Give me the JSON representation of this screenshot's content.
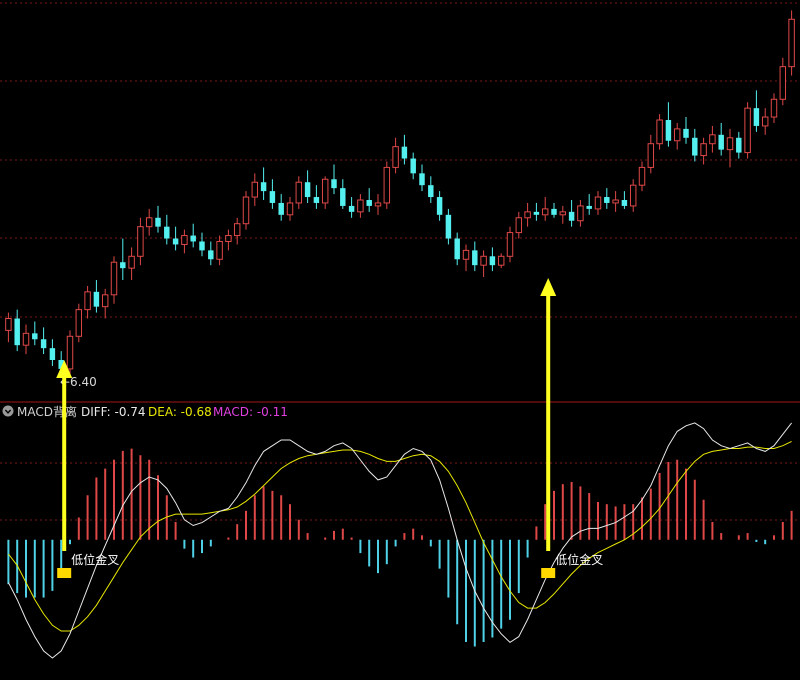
{
  "colors": {
    "background": "#000000",
    "up_candle": "#e04848",
    "down_candle": "#54f0f0",
    "grid": "#7a1a1a",
    "divider": "#a01818",
    "diff_line": "#e8e8e8",
    "dea_line": "#e8e800",
    "macd_pos": "#e04848",
    "macd_neg": "#4fd2e8",
    "arrow": "#ffff20",
    "signal_marker": "#ffd800",
    "legend_label": "#cfcfcf",
    "dea_label": "#e8e800",
    "macd_label": "#e040e0",
    "low_marker": "#d8d8d8"
  },
  "icons": {
    "panel_toggle": "chevron-down-circle-icon"
  },
  "price_panel": {
    "low_marker_label": "←6.40"
  },
  "macd_panel": {
    "indicator_name": "MACD背离",
    "diff_label": "DIFF: -0.74",
    "dea_label": "DEA: -0.68",
    "macd_label": "MACD: -0.11"
  },
  "chart_data": [
    {
      "type": "candlestick",
      "title": "",
      "xlabel": "",
      "ylabel": "",
      "grid": true,
      "ylim": [
        6.25,
        8.95
      ],
      "candles": [
        [
          6.72,
          6.84,
          6.64,
          6.8
        ],
        [
          6.8,
          6.86,
          6.58,
          6.62
        ],
        [
          6.62,
          6.76,
          6.56,
          6.7
        ],
        [
          6.7,
          6.78,
          6.62,
          6.66
        ],
        [
          6.66,
          6.74,
          6.56,
          6.6
        ],
        [
          6.6,
          6.66,
          6.48,
          6.52
        ],
        [
          6.52,
          6.58,
          6.42,
          6.46
        ],
        [
          6.46,
          6.72,
          6.4,
          6.68
        ],
        [
          6.68,
          6.9,
          6.64,
          6.86
        ],
        [
          6.86,
          7.02,
          6.8,
          6.98
        ],
        [
          6.98,
          7.06,
          6.84,
          6.88
        ],
        [
          6.88,
          7.0,
          6.8,
          6.96
        ],
        [
          6.96,
          7.22,
          6.9,
          7.18
        ],
        [
          7.18,
          7.34,
          7.06,
          7.14
        ],
        [
          7.14,
          7.28,
          7.06,
          7.22
        ],
        [
          7.22,
          7.48,
          7.16,
          7.42
        ],
        [
          7.42,
          7.54,
          7.36,
          7.48
        ],
        [
          7.48,
          7.56,
          7.38,
          7.42
        ],
        [
          7.42,
          7.5,
          7.3,
          7.34
        ],
        [
          7.34,
          7.42,
          7.26,
          7.3
        ],
        [
          7.3,
          7.4,
          7.24,
          7.36
        ],
        [
          7.36,
          7.44,
          7.28,
          7.32
        ],
        [
          7.32,
          7.38,
          7.22,
          7.26
        ],
        [
          7.26,
          7.32,
          7.16,
          7.2
        ],
        [
          7.2,
          7.36,
          7.16,
          7.32
        ],
        [
          7.32,
          7.4,
          7.26,
          7.36
        ],
        [
          7.36,
          7.48,
          7.3,
          7.44
        ],
        [
          7.44,
          7.66,
          7.4,
          7.62
        ],
        [
          7.62,
          7.78,
          7.56,
          7.72
        ],
        [
          7.72,
          7.82,
          7.6,
          7.66
        ],
        [
          7.66,
          7.74,
          7.54,
          7.58
        ],
        [
          7.58,
          7.64,
          7.46,
          7.5
        ],
        [
          7.5,
          7.62,
          7.46,
          7.58
        ],
        [
          7.58,
          7.76,
          7.54,
          7.72
        ],
        [
          7.72,
          7.8,
          7.58,
          7.62
        ],
        [
          7.62,
          7.7,
          7.54,
          7.58
        ],
        [
          7.58,
          7.76,
          7.54,
          7.74
        ],
        [
          7.74,
          7.84,
          7.64,
          7.68
        ],
        [
          7.68,
          7.74,
          7.54,
          7.56
        ],
        [
          7.56,
          7.62,
          7.48,
          7.52
        ],
        [
          7.52,
          7.64,
          7.48,
          7.6
        ],
        [
          7.6,
          7.68,
          7.52,
          7.56
        ],
        [
          7.56,
          7.64,
          7.5,
          7.58
        ],
        [
          7.58,
          7.86,
          7.54,
          7.82
        ],
        [
          7.82,
          8.02,
          7.78,
          7.96
        ],
        [
          7.96,
          8.04,
          7.84,
          7.88
        ],
        [
          7.88,
          7.92,
          7.74,
          7.78
        ],
        [
          7.78,
          7.84,
          7.66,
          7.7
        ],
        [
          7.7,
          7.76,
          7.58,
          7.62
        ],
        [
          7.62,
          7.66,
          7.46,
          7.5
        ],
        [
          7.5,
          7.54,
          7.3,
          7.34
        ],
        [
          7.34,
          7.38,
          7.16,
          7.2
        ],
        [
          7.2,
          7.3,
          7.12,
          7.26
        ],
        [
          7.26,
          7.32,
          7.12,
          7.16
        ],
        [
          7.16,
          7.26,
          7.08,
          7.22
        ],
        [
          7.22,
          7.28,
          7.12,
          7.16
        ],
        [
          7.16,
          7.24,
          7.14,
          7.22
        ],
        [
          7.22,
          7.42,
          7.18,
          7.38
        ],
        [
          7.38,
          7.52,
          7.34,
          7.48
        ],
        [
          7.48,
          7.58,
          7.42,
          7.52
        ],
        [
          7.52,
          7.58,
          7.46,
          7.5
        ],
        [
          7.5,
          7.62,
          7.46,
          7.54
        ],
        [
          7.54,
          7.58,
          7.48,
          7.5
        ],
        [
          7.5,
          7.56,
          7.44,
          7.52
        ],
        [
          7.52,
          7.6,
          7.42,
          7.46
        ],
        [
          7.46,
          7.6,
          7.42,
          7.56
        ],
        [
          7.56,
          7.64,
          7.5,
          7.54
        ],
        [
          7.54,
          7.66,
          7.5,
          7.62
        ],
        [
          7.62,
          7.68,
          7.54,
          7.58
        ],
        [
          7.58,
          7.66,
          7.52,
          7.6
        ],
        [
          7.6,
          7.66,
          7.54,
          7.56
        ],
        [
          7.56,
          7.74,
          7.52,
          7.7
        ],
        [
          7.7,
          7.86,
          7.66,
          7.82
        ],
        [
          7.82,
          8.04,
          7.78,
          7.98
        ],
        [
          7.98,
          8.18,
          7.94,
          8.14
        ],
        [
          8.14,
          8.26,
          7.96,
          8.0
        ],
        [
          8.0,
          8.12,
          7.94,
          8.08
        ],
        [
          8.08,
          8.16,
          7.98,
          8.02
        ],
        [
          8.02,
          8.08,
          7.86,
          7.9
        ],
        [
          7.9,
          8.02,
          7.84,
          7.98
        ],
        [
          7.98,
          8.1,
          7.92,
          8.04
        ],
        [
          8.04,
          8.12,
          7.9,
          7.94
        ],
        [
          7.94,
          8.08,
          7.82,
          8.02
        ],
        [
          8.02,
          8.06,
          7.88,
          7.92
        ],
        [
          7.92,
          8.26,
          7.88,
          8.22
        ],
        [
          8.22,
          8.34,
          8.06,
          8.1
        ],
        [
          8.1,
          8.22,
          8.04,
          8.16
        ],
        [
          8.16,
          8.32,
          8.12,
          8.28
        ],
        [
          8.28,
          8.56,
          8.24,
          8.5
        ],
        [
          8.5,
          8.88,
          8.44,
          8.82
        ]
      ]
    },
    {
      "type": "line+bar",
      "title": "",
      "xlabel": "",
      "ylabel": "",
      "grid": true,
      "ylim": [
        -0.9,
        0.7
      ],
      "series": [
        {
          "name": "DIFF",
          "values": [
            -0.3,
            -0.42,
            -0.56,
            -0.68,
            -0.78,
            -0.83,
            -0.78,
            -0.66,
            -0.5,
            -0.34,
            -0.18,
            -0.04,
            0.1,
            0.24,
            0.34,
            0.4,
            0.44,
            0.42,
            0.36,
            0.26,
            0.14,
            0.1,
            0.12,
            0.16,
            0.2,
            0.22,
            0.3,
            0.4,
            0.52,
            0.62,
            0.66,
            0.7,
            0.7,
            0.66,
            0.62,
            0.6,
            0.62,
            0.66,
            0.68,
            0.64,
            0.56,
            0.48,
            0.42,
            0.44,
            0.52,
            0.6,
            0.64,
            0.62,
            0.56,
            0.42,
            0.22,
            0.0,
            -0.2,
            -0.36,
            -0.48,
            -0.58,
            -0.66,
            -0.72,
            -0.68,
            -0.56,
            -0.42,
            -0.28,
            -0.16,
            -0.06,
            0.02,
            0.06,
            0.08,
            0.08,
            0.1,
            0.12,
            0.16,
            0.2,
            0.28,
            0.38,
            0.52,
            0.66,
            0.76,
            0.8,
            0.82,
            0.78,
            0.7,
            0.66,
            0.64,
            0.66,
            0.68,
            0.64,
            0.62,
            0.66,
            0.74,
            0.82
          ]
        },
        {
          "name": "DEA",
          "values": [
            -0.1,
            -0.18,
            -0.3,
            -0.42,
            -0.52,
            -0.6,
            -0.64,
            -0.64,
            -0.6,
            -0.54,
            -0.46,
            -0.36,
            -0.26,
            -0.16,
            -0.07,
            0.02,
            0.08,
            0.13,
            0.16,
            0.18,
            0.18,
            0.18,
            0.18,
            0.19,
            0.2,
            0.21,
            0.23,
            0.27,
            0.32,
            0.38,
            0.44,
            0.5,
            0.54,
            0.57,
            0.59,
            0.6,
            0.61,
            0.62,
            0.63,
            0.63,
            0.62,
            0.6,
            0.57,
            0.55,
            0.55,
            0.57,
            0.59,
            0.6,
            0.59,
            0.55,
            0.48,
            0.38,
            0.26,
            0.12,
            -0.02,
            -0.14,
            -0.26,
            -0.36,
            -0.44,
            -0.48,
            -0.48,
            -0.44,
            -0.38,
            -0.31,
            -0.24,
            -0.18,
            -0.13,
            -0.09,
            -0.06,
            -0.03,
            0.0,
            0.04,
            0.09,
            0.15,
            0.22,
            0.31,
            0.4,
            0.48,
            0.55,
            0.6,
            0.62,
            0.63,
            0.64,
            0.64,
            0.65,
            0.65,
            0.64,
            0.64,
            0.66,
            0.69
          ]
        },
        {
          "name": "MACD",
          "values": [
            -0.4,
            -0.48,
            -0.52,
            -0.52,
            -0.52,
            -0.46,
            -0.28,
            -0.04,
            0.2,
            0.4,
            0.56,
            0.64,
            0.72,
            0.8,
            0.82,
            0.76,
            0.72,
            0.58,
            0.4,
            0.16,
            -0.08,
            -0.16,
            -0.12,
            -0.06,
            0.0,
            0.02,
            0.14,
            0.26,
            0.4,
            0.48,
            0.44,
            0.4,
            0.32,
            0.18,
            0.06,
            0.0,
            0.02,
            0.08,
            0.1,
            0.02,
            -0.12,
            -0.24,
            -0.3,
            -0.22,
            -0.06,
            0.06,
            0.1,
            0.04,
            -0.06,
            -0.26,
            -0.52,
            -0.76,
            -0.92,
            -0.96,
            -0.92,
            -0.88,
            -0.8,
            -0.72,
            -0.48,
            -0.16,
            0.12,
            0.32,
            0.44,
            0.5,
            0.52,
            0.48,
            0.42,
            0.34,
            0.32,
            0.3,
            0.32,
            0.32,
            0.38,
            0.46,
            0.6,
            0.7,
            0.72,
            0.64,
            0.54,
            0.36,
            0.16,
            0.06,
            0.0,
            0.04,
            0.06,
            -0.02,
            -0.04,
            0.04,
            0.16,
            0.26
          ]
        }
      ],
      "annotations": [
        {
          "text": "低位金叉",
          "index": 6
        },
        {
          "text": "低位金叉",
          "index": 61
        }
      ]
    }
  ]
}
